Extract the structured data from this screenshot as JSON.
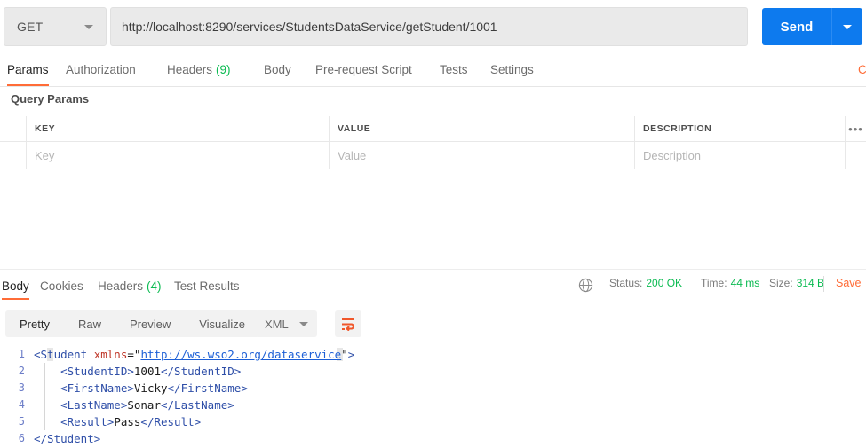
{
  "request": {
    "method": "GET",
    "url": "http://localhost:8290/services/StudentsDataService/getStudent/1001",
    "send_label": "Send",
    "send_caret_icon": "chevron-down-icon",
    "method_caret_icon": "chevron-down-icon",
    "tabs": [
      {
        "label": "Params",
        "count": "",
        "active": true
      },
      {
        "label": "Authorization",
        "count": "",
        "active": false
      },
      {
        "label": "Headers",
        "count": "(9)",
        "active": false
      },
      {
        "label": "Body",
        "count": "",
        "active": false
      },
      {
        "label": "Pre-request Script",
        "count": "",
        "active": false
      },
      {
        "label": "Tests",
        "count": "",
        "active": false
      },
      {
        "label": "Settings",
        "count": "",
        "active": false
      }
    ],
    "cookies_link": "Cookies"
  },
  "params": {
    "section_title": "Query Params",
    "columns": [
      "KEY",
      "VALUE",
      "DESCRIPTION"
    ],
    "more_icon": "ellipsis-icon",
    "rows": [
      {
        "key_placeholder": "Key",
        "value_placeholder": "Value",
        "description_placeholder": "Description"
      }
    ]
  },
  "response": {
    "tabs": [
      {
        "label": "Body",
        "count": "",
        "active": true
      },
      {
        "label": "Cookies",
        "count": "",
        "active": false
      },
      {
        "label": "Headers",
        "count": "(4)",
        "active": false
      },
      {
        "label": "Test Results",
        "count": "",
        "active": false
      }
    ],
    "network_icon": "globe-icon",
    "status_label": "Status:",
    "status_value": "200 OK",
    "time_label": "Time:",
    "time_value": "44 ms",
    "size_label": "Size:",
    "size_value": "314 B",
    "save_label": "Save",
    "view_modes": [
      {
        "label": "Pretty",
        "active": true
      },
      {
        "label": "Raw",
        "active": false
      },
      {
        "label": "Preview",
        "active": false
      },
      {
        "label": "Visualize",
        "active": false
      }
    ],
    "language": "XML",
    "language_caret_icon": "chevron-down-icon",
    "wrap_icon": "word-wrap-icon",
    "body_lines": [
      {
        "n": "1",
        "segments": [
          {
            "t": "<Student ",
            "c": "tg"
          },
          {
            "t": "xmlns",
            "c": "at"
          },
          {
            "t": "=\"",
            "c": "q"
          },
          {
            "t": "http://ws.wso2.org/dataservice",
            "c": "lnk"
          },
          {
            "t": "\"",
            "c": "q"
          },
          {
            "t": ">",
            "c": "tg"
          }
        ]
      },
      {
        "n": "2",
        "segments": [
          {
            "t": "    <StudentID>",
            "c": "tg"
          },
          {
            "t": "1001",
            "c": "q"
          },
          {
            "t": "</StudentID>",
            "c": "tg"
          }
        ]
      },
      {
        "n": "3",
        "segments": [
          {
            "t": "    <FirstName>",
            "c": "tg"
          },
          {
            "t": "Vicky",
            "c": "q"
          },
          {
            "t": "</FirstName>",
            "c": "tg"
          }
        ]
      },
      {
        "n": "4",
        "segments": [
          {
            "t": "    <LastName>",
            "c": "tg"
          },
          {
            "t": "Sonar",
            "c": "q"
          },
          {
            "t": "</LastName>",
            "c": "tg"
          }
        ]
      },
      {
        "n": "5",
        "segments": [
          {
            "t": "    <Result>",
            "c": "tg"
          },
          {
            "t": "Pass",
            "c": "q"
          },
          {
            "t": "</Result>",
            "c": "tg"
          }
        ]
      },
      {
        "n": "6",
        "segments": [
          {
            "t": "</Student>",
            "c": "tg"
          }
        ]
      }
    ]
  },
  "colors": {
    "accent": "#ff6c37",
    "send": "#0d7aee",
    "success": "#0cbb52"
  }
}
